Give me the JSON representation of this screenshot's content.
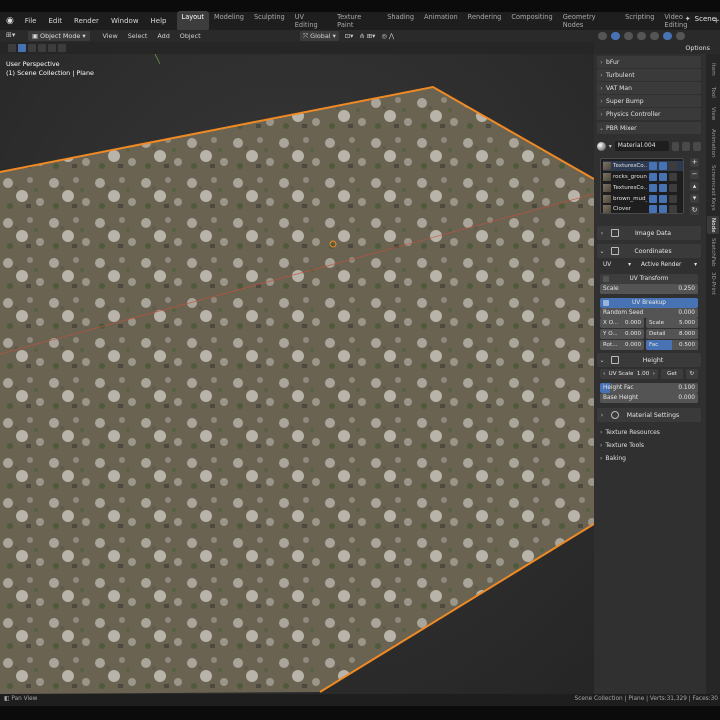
{
  "menu": {
    "items": [
      "File",
      "Edit",
      "Render",
      "Window",
      "Help"
    ],
    "workspaces": [
      "Layout",
      "Modeling",
      "Sculpting",
      "UV Editing",
      "Texture Paint",
      "Shading",
      "Animation",
      "Rendering",
      "Compositing",
      "Geometry Nodes",
      "Scripting",
      "Video Editing"
    ],
    "active_workspace": "Layout",
    "scene_label": "Scene"
  },
  "viewport_header": {
    "mode": "Object Mode",
    "menus": [
      "View",
      "Select",
      "Add",
      "Object"
    ],
    "orientation": "Global"
  },
  "right_header": {
    "options_label": "Options"
  },
  "viewport": {
    "perspective_label": "User Perspective",
    "collection_label": "(1) Scene Collection | Plane",
    "plane_fill": "#6d6656",
    "outline_color": "#f08a24"
  },
  "npanel": {
    "collapsed_panels": [
      "bFur",
      "Turbulent",
      "VAT Man",
      "Super Bump",
      "Physics Controller"
    ],
    "pbr_mixer_label": "PBR Mixer",
    "material_name": "Material.004",
    "texture_list": [
      "TexturesCo...",
      "rocks_groun...",
      "TexturesCo...",
      "brown_mud_...",
      "Clover"
    ],
    "image_data_label": "Image Data",
    "coordinates_label": "Coordinates",
    "coord_type": "UV",
    "coord_render": "Active Render",
    "uv_transform_label": "UV Transform",
    "scale_label": "Scale",
    "scale_value": "0.250",
    "uv_breakup_label": "UV Breakup",
    "random_seed_label": "Random Seed",
    "random_seed_value": "0.000",
    "x_label": "X O...",
    "x_value": "0.000",
    "y_label": "Y O...",
    "y_value": "0.000",
    "rot_label": "Rot...",
    "rot_value": "0.000",
    "breakup_scale_label": "Scale",
    "breakup_scale_value": "5.000",
    "detail_label": "Detail",
    "detail_value": "8.000",
    "fac_label": "Fac",
    "fac_value": "0.500",
    "height_label": "Height",
    "uv_scale_label": "UV Scale",
    "uv_scale_value": "1.00",
    "get_label": "Get",
    "height_fac_label": "Height Fac",
    "height_fac_value": "0.100",
    "base_height_label": "Base Height",
    "base_height_value": "0.000",
    "material_settings_label": "Material Settings",
    "sub_items": [
      "Texture Resources",
      "Texture Tools",
      "Baking"
    ]
  },
  "vertical_tabs": [
    "Item",
    "Tool",
    "View",
    "Animation",
    "Screencast Keys",
    "Node",
    "SketchFab",
    "3D-Print"
  ],
  "active_vtab": "Node",
  "status": {
    "left": "Pan View",
    "right": "Scene Collection | Plane | Verts:31,329 | Faces:30"
  }
}
